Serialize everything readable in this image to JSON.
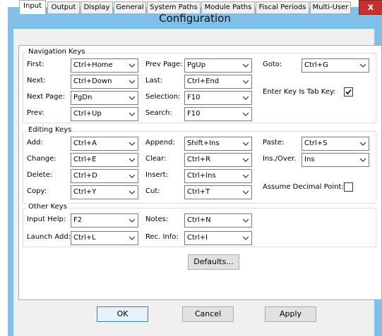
{
  "window": {
    "title": "Configuration",
    "close_glyph": "x"
  },
  "tabs": [
    "Input",
    "Output",
    "Display",
    "General",
    "System Paths",
    "Module Paths",
    "Fiscal Periods",
    "Multi-User"
  ],
  "active_tab": "Input",
  "nav": {
    "group_label": "Navigation Keys",
    "first": {
      "label": "First:",
      "value": "Ctrl+Home"
    },
    "next": {
      "label": "Next:",
      "value": "Ctrl+Down"
    },
    "next_page": {
      "label": "Next Page:",
      "value": "PgDn"
    },
    "prev": {
      "label": "Prev:",
      "value": "Ctrl+Up"
    },
    "prev_page": {
      "label": "Prev Page:",
      "value": "PgUp"
    },
    "last": {
      "label": "Last:",
      "value": "Ctrl+End"
    },
    "selection": {
      "label": "Selection:",
      "value": "F10"
    },
    "search": {
      "label": "Search:",
      "value": "F10"
    },
    "goto": {
      "label": "Goto:",
      "value": "Ctrl+G"
    },
    "enter_tab": {
      "label": "Enter Key Is Tab Key:",
      "checked": true
    }
  },
  "edit": {
    "group_label": "Editing Keys",
    "add": {
      "label": "Add:",
      "value": "Ctrl+A"
    },
    "change": {
      "label": "Change:",
      "value": "Ctrl+E"
    },
    "delete": {
      "label": "Delete:",
      "value": "Ctrl+D"
    },
    "copy": {
      "label": "Copy:",
      "value": "Ctrl+Y"
    },
    "append": {
      "label": "Append:",
      "value": "Shift+Ins"
    },
    "clear": {
      "label": "Clear:",
      "value": "Ctrl+R"
    },
    "insert": {
      "label": "Insert:",
      "value": "Ctrl+Ins"
    },
    "cut": {
      "label": "Cut:",
      "value": "Ctrl+T"
    },
    "paste": {
      "label": "Paste:",
      "value": "Ctrl+S"
    },
    "ins_over": {
      "label": "Ins./Over.",
      "value": "Ins"
    },
    "assume_decimal": {
      "label": "Assume Decimal Point:",
      "checked": false
    }
  },
  "other": {
    "group_label": "Other Keys",
    "input_help": {
      "label": "Input Help:",
      "value": "F2"
    },
    "launch_add": {
      "label": "Launch Add:",
      "value": "Ctrl+L"
    },
    "notes": {
      "label": "Notes:",
      "value": "Ctrl+N"
    },
    "rec_info": {
      "label": "Rec. Info:",
      "value": "Ctrl+I"
    }
  },
  "buttons": {
    "defaults": "Defaults...",
    "ok": "OK",
    "cancel": "Cancel",
    "apply": "Apply"
  },
  "colors": {
    "titlebar": "#7fc0e8",
    "close": "#c9302c",
    "panel": "#ffffff",
    "dialog": "#f0f0f0"
  }
}
